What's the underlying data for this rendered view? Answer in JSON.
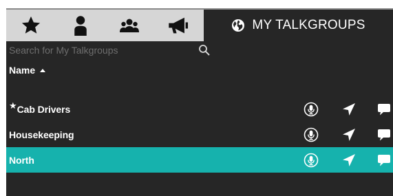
{
  "tabs": {
    "icon_tabs": [
      {
        "icon": "star-icon"
      },
      {
        "icon": "user-icon"
      },
      {
        "icon": "group-icon"
      },
      {
        "icon": "megaphone-icon"
      }
    ],
    "active_tab": {
      "icon": "globe-icon",
      "label": "MY TALKGROUPS"
    }
  },
  "search": {
    "placeholder": "Search for My Talkgroups",
    "value": "",
    "icon": "search-icon"
  },
  "list": {
    "header": {
      "label": "Name",
      "sort": "ascending",
      "sort_icon": "sort-up-icon"
    },
    "rows": [
      {
        "name": "Cab Drivers",
        "favorite": true,
        "selected": false,
        "favorite_mark": "★"
      },
      {
        "name": "Housekeeping",
        "favorite": false,
        "selected": false
      },
      {
        "name": "North",
        "favorite": false,
        "selected": true
      }
    ],
    "row_actions": [
      "microphone-icon",
      "location-arrow-icon",
      "message-icon"
    ]
  },
  "colors": {
    "background": "#262626",
    "tab_strip": "#d6d6d6",
    "selected_row": "#16b2ad",
    "text": "#ffffff",
    "placeholder": "#6e6e6e"
  }
}
